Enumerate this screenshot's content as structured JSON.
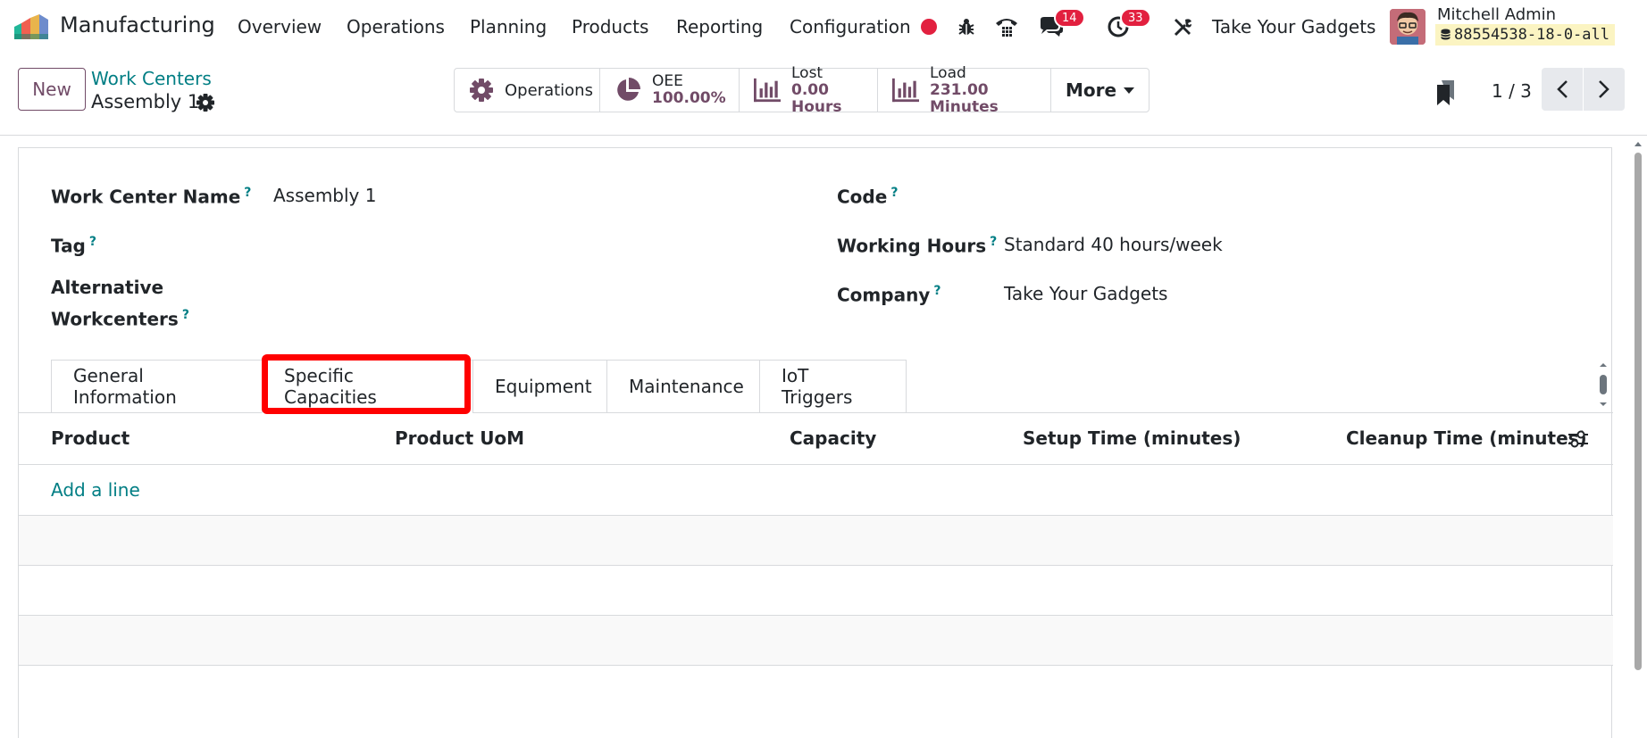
{
  "app": {
    "name": "Manufacturing",
    "logo_colors": [
      "#f06050",
      "#21b799",
      "#6e8ccc",
      "#e9b44c"
    ]
  },
  "menu": [
    {
      "label": "Overview"
    },
    {
      "label": "Operations"
    },
    {
      "label": "Planning"
    },
    {
      "label": "Products"
    },
    {
      "label": "Reporting"
    },
    {
      "label": "Configuration"
    }
  ],
  "systray": {
    "record_dot_color": "#e2203f",
    "icons": [
      "record-dot-icon",
      "bug-icon",
      "phone-icon",
      "chat-icon",
      "activity-clock-icon",
      "tools-icon"
    ],
    "messages_badge": "14",
    "activities_badge": "33",
    "company": "Take Your Gadgets",
    "user_name": "Mitchell Admin",
    "database": "88554538-18-0-all"
  },
  "control": {
    "new_label": "New",
    "breadcrumb": "Work Centers",
    "record_name": "Assembly 1",
    "smart_buttons": {
      "operations": {
        "label": "Operations"
      },
      "oee": {
        "label": "OEE",
        "value": "100.00%"
      },
      "lost": {
        "label": "Lost",
        "value": "0.00 Hours"
      },
      "load": {
        "label": "Load",
        "value": "231.00 Minutes"
      },
      "more": {
        "label": "More"
      }
    },
    "pager": "1 / 3"
  },
  "form": {
    "fields": {
      "work_center_name": {
        "label": "Work Center Name",
        "help": "?",
        "value": "Assembly 1"
      },
      "tag": {
        "label": "Tag",
        "help": "?",
        "value": ""
      },
      "alternative_line1": "Alternative",
      "alternative_line2": "Workcenters",
      "alternative_help": "?",
      "code": {
        "label": "Code",
        "help": "?",
        "value": ""
      },
      "working_hours": {
        "label": "Working Hours",
        "help": "?",
        "value": "Standard 40 hours/week"
      },
      "company": {
        "label": "Company",
        "help": "?",
        "value": "Take Your Gadgets"
      }
    },
    "tabs": [
      {
        "label": "General Information"
      },
      {
        "label": "Specific Capacities",
        "active": true
      },
      {
        "label": "Equipment"
      },
      {
        "label": "Maintenance"
      },
      {
        "label": "IoT Triggers"
      }
    ],
    "table": {
      "columns": [
        "Product",
        "Product UoM",
        "Capacity",
        "Setup Time (minutes)",
        "Cleanup Time (minutes)"
      ],
      "add_line": "Add a line"
    }
  },
  "colors": {
    "brand": "#714b67",
    "link": "#017e84",
    "highlight": "#ff0000"
  }
}
